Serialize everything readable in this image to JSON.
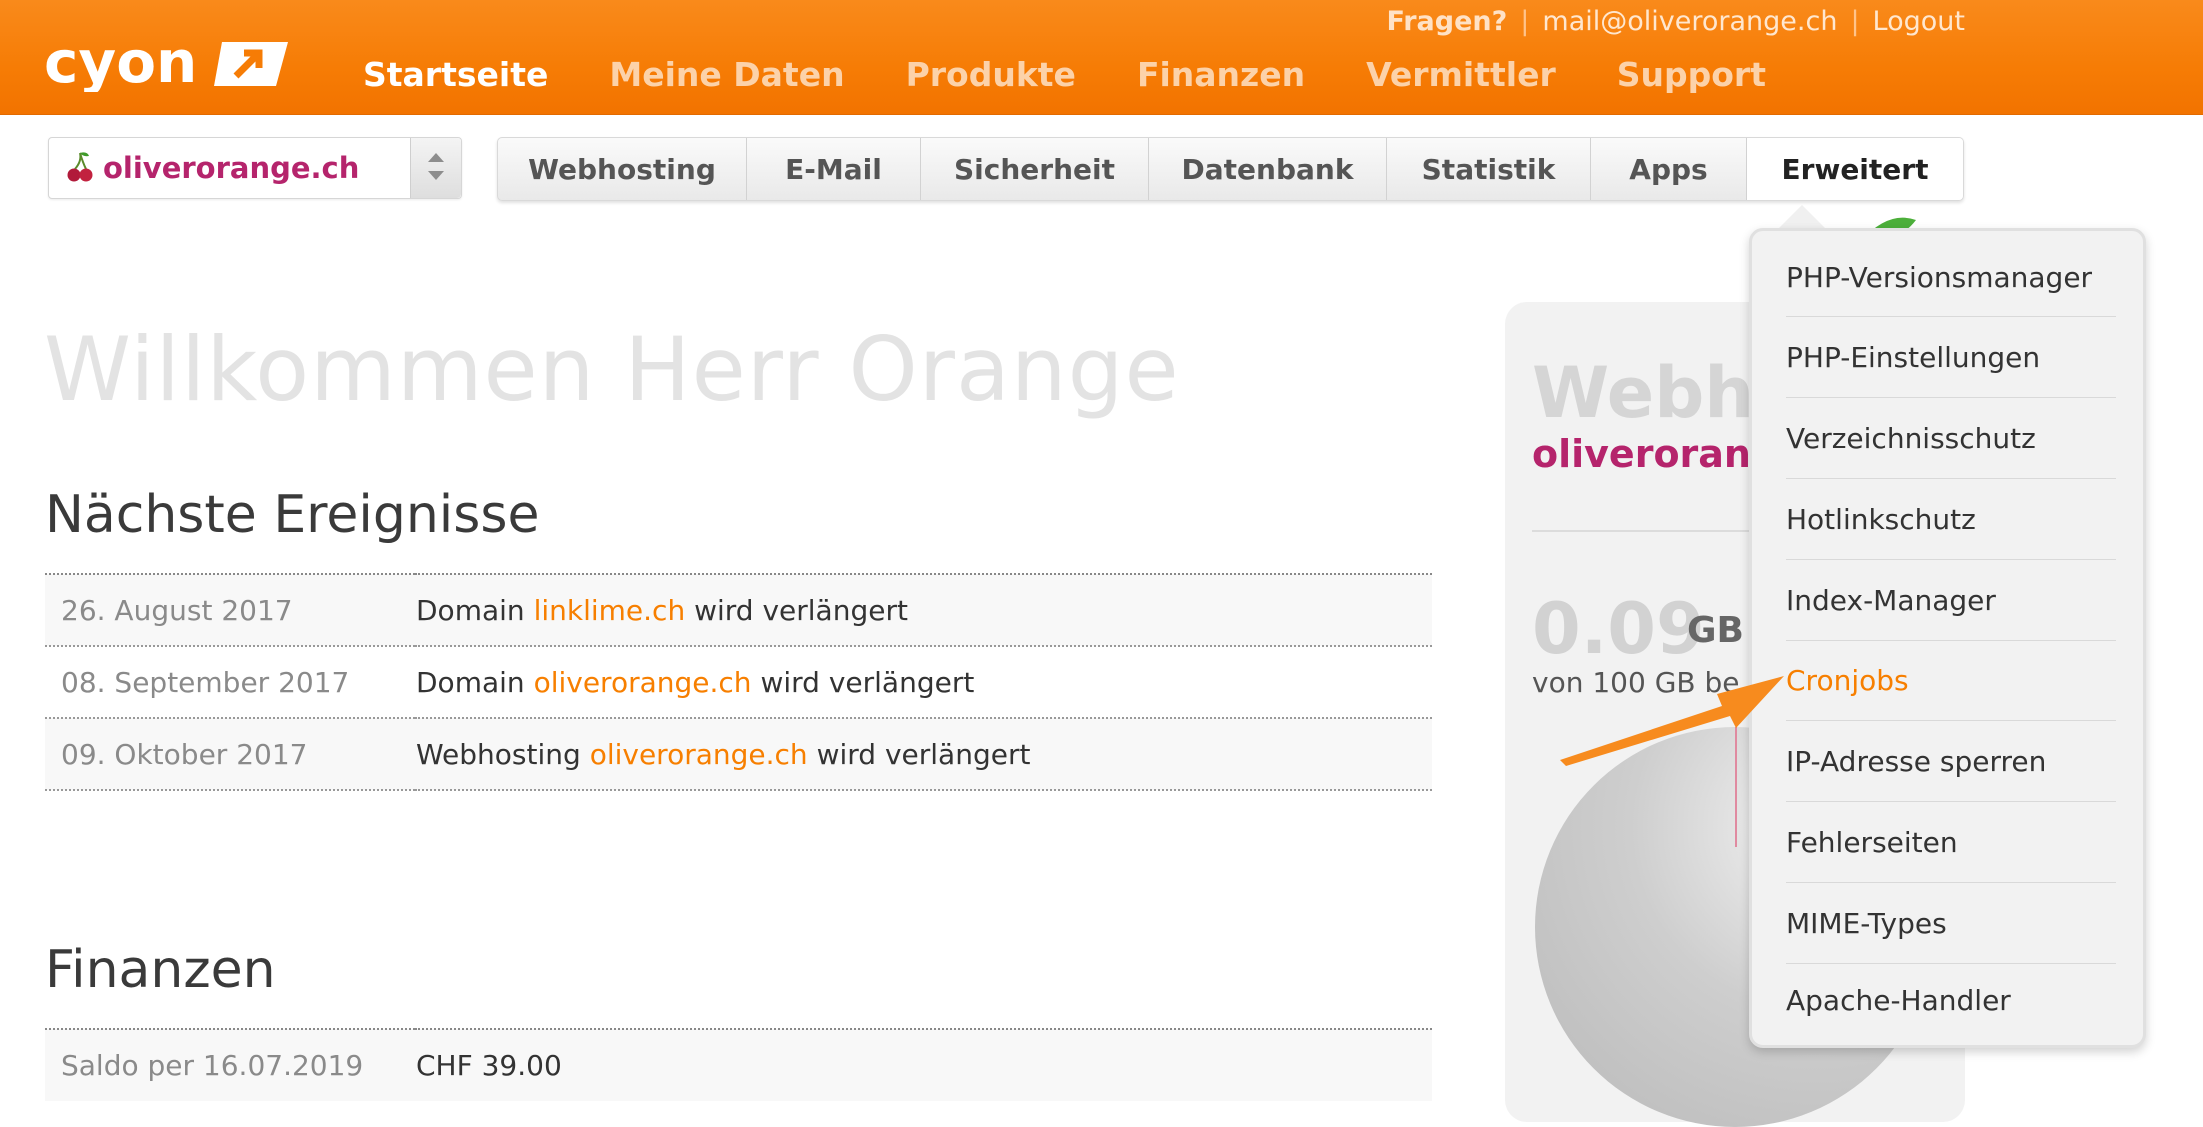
{
  "header": {
    "logo_text": "cyon",
    "top_links": {
      "question": "Fragen?",
      "email": "mail@oliverorange.ch",
      "logout": "Logout"
    },
    "nav": [
      "Startseite",
      "Meine Daten",
      "Produkte",
      "Finanzen",
      "Vermittler",
      "Support"
    ]
  },
  "domain_select": {
    "value": "oliverorange.ch"
  },
  "tabs": [
    "Webhosting",
    "E-Mail",
    "Sicherheit",
    "Datenbank",
    "Statistik",
    "Apps",
    "Erweitert"
  ],
  "welcome": "Willkommen Herr Orange",
  "events": {
    "title": "Nächste Ereignisse",
    "rows": [
      {
        "date": "26. August 2017",
        "pre": "Domain ",
        "link": "linklime.ch",
        "post": " wird verlängert"
      },
      {
        "date": "08. September 2017",
        "pre": "Domain ",
        "link": "oliverorange.ch",
        "post": " wird verlängert"
      },
      {
        "date": "09. Oktober 2017",
        "pre": "Webhosting ",
        "link": "oliverorange.ch",
        "post": " wird verlängert"
      }
    ]
  },
  "finanzen": {
    "title": "Finanzen",
    "rows": [
      {
        "label": "Saldo per 16.07.2019",
        "value": "CHF 39.00"
      }
    ]
  },
  "widget": {
    "title": "Webho",
    "domain": "oliverorange",
    "value": "0.09",
    "unit": "GB",
    "sub": "von 100 GB be"
  },
  "dropdown": {
    "items": [
      "PHP-Versionsmanager",
      "PHP-Einstellungen",
      "Verzeichnisschutz",
      "Hotlinkschutz",
      "Index-Manager",
      "Cronjobs",
      "IP-Adresse sperren",
      "Fehlerseiten",
      "MIME-Types",
      "Apache-Handler"
    ],
    "highlighted": "Cronjobs"
  },
  "colors": {
    "brand_orange": "#f67c05",
    "link_orange": "#f77f00",
    "domain_magenta": "#b5246c"
  }
}
